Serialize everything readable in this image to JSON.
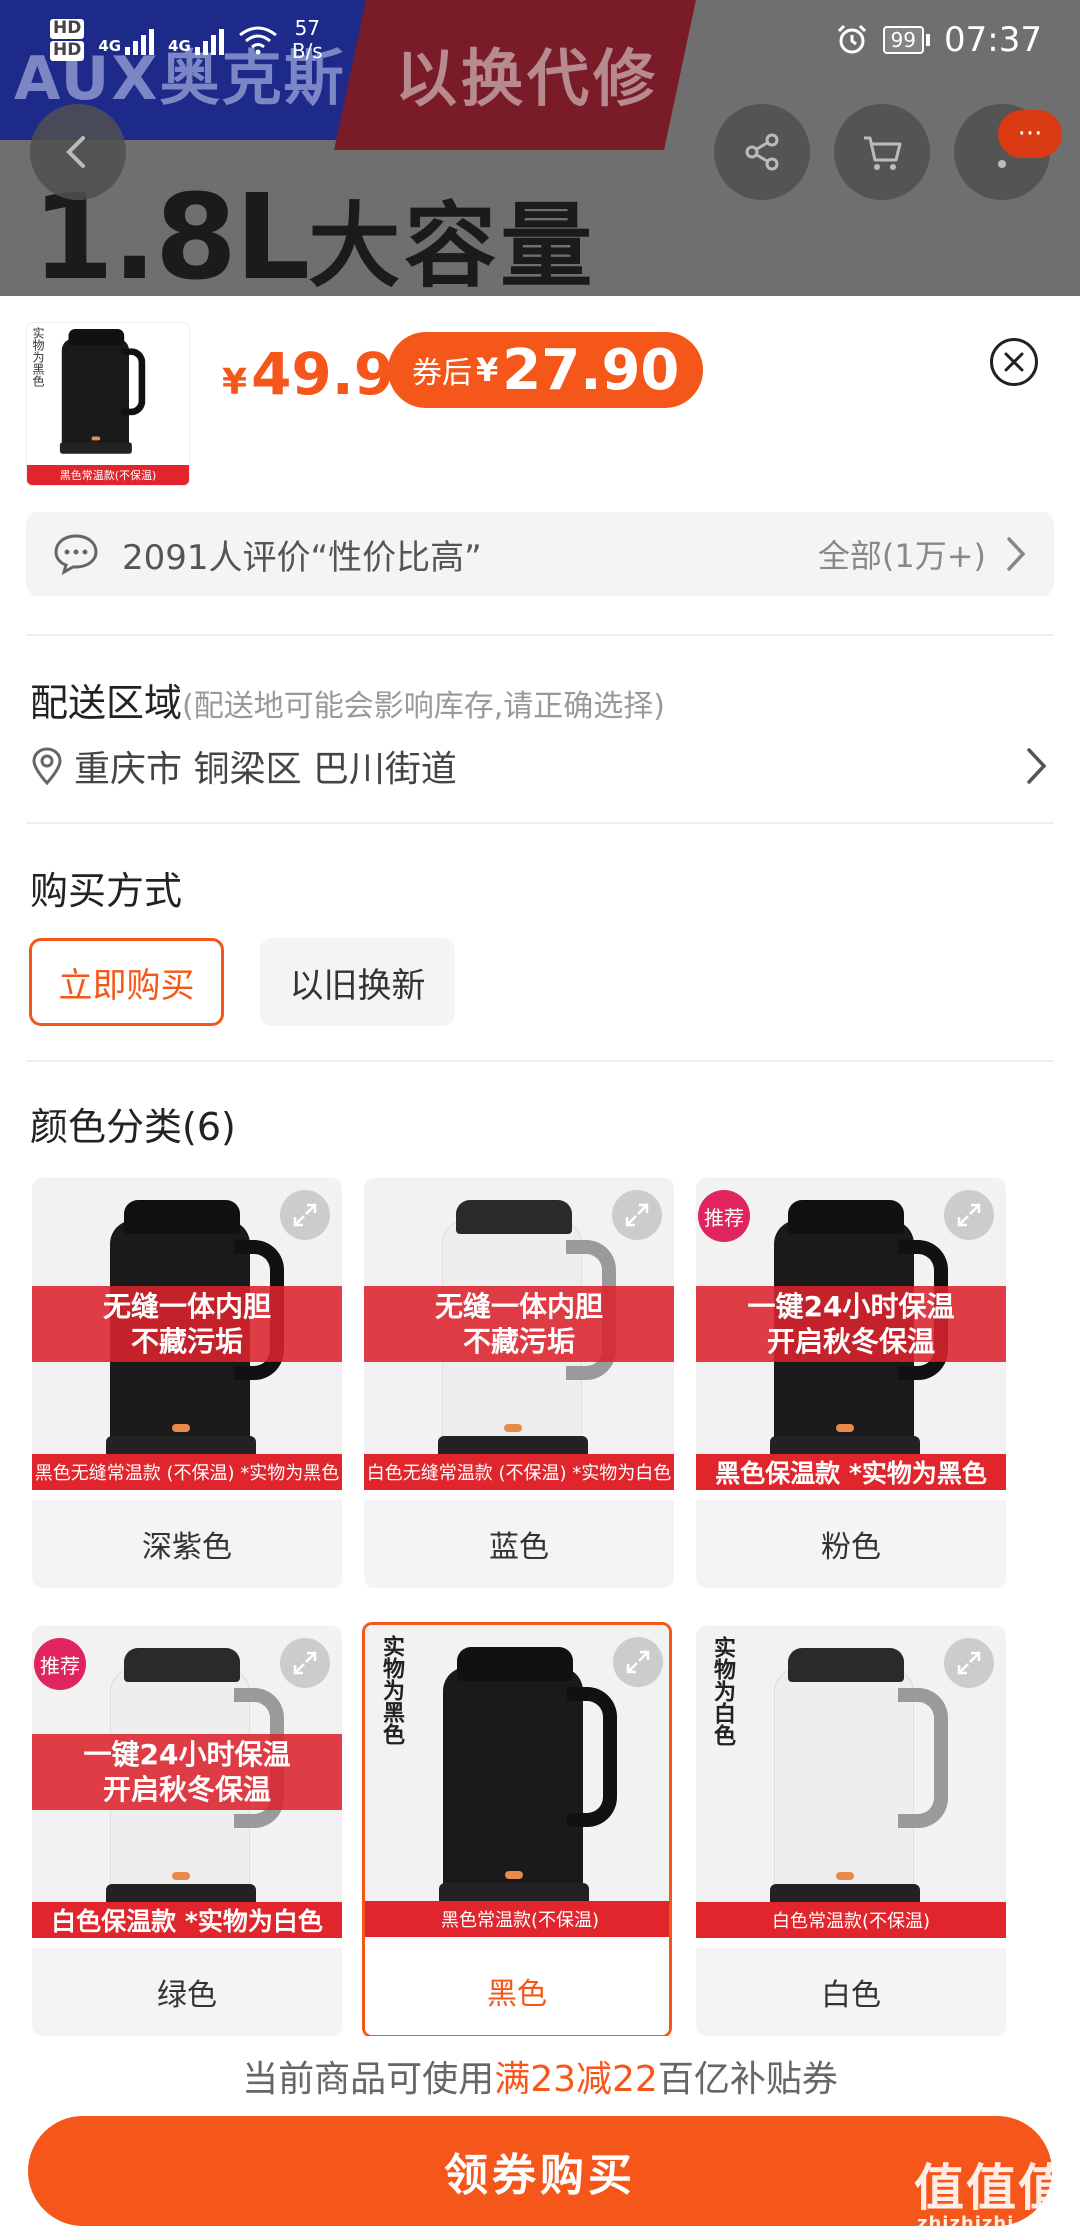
{
  "statusbar": {
    "hd1": "HD",
    "hd2": "HD",
    "net1": "4G",
    "net2": "4G",
    "speed_value": "57",
    "speed_unit": "B/s",
    "battery": "99",
    "time": "07:37"
  },
  "backdrop": {
    "brand": "AUX奥克斯",
    "slogan": "以换代修",
    "headline": "1.8L",
    "headline_sub": "大容量",
    "more_label": "···"
  },
  "product": {
    "thumb_vertical_label": "实物为黑色",
    "thumb_strip": "黑色常温款(不保温)",
    "price_currency": "¥",
    "price": "49.9",
    "coupon_label": "券后",
    "coupon_currency": "¥",
    "coupon_price": "27.90"
  },
  "review": {
    "text": "2091人评价“性价比高”",
    "all": "全部(1万+)"
  },
  "delivery": {
    "title": "配送区域",
    "hint": "(配送地可能会影响库存,请正确选择)",
    "address": "重庆市 铜梁区 巴川街道"
  },
  "purchase": {
    "title": "购买方式",
    "options": [
      "立即购买",
      "以旧换新"
    ]
  },
  "colors": {
    "title": "颜色分类(6)",
    "items": [
      {
        "name": "深紫色",
        "banner1": "无缝一体内胆",
        "banner2": "不藏污垢",
        "strip": "黑色无缝常温款 (不保温) *实物为黑色"
      },
      {
        "name": "蓝色",
        "banner1": "无缝一体内胆",
        "banner2": "不藏污垢",
        "strip": "白色无缝常温款 (不保温) *实物为白色"
      },
      {
        "name": "粉色",
        "tag": "推荐",
        "banner1": "一键24小时保温",
        "banner2": "开启秋冬保温",
        "strip": "黑色保温款 *实物为黑色"
      },
      {
        "name": "绿色",
        "tag": "推荐",
        "banner1": "一键24小时保温",
        "banner2": "开启秋冬保温",
        "strip": "白色保温款 *实物为白色"
      },
      {
        "name": "黑色",
        "vtag": "实物为黑色",
        "strip": "黑色常温款(不保温)"
      },
      {
        "name": "白色",
        "vtag": "实物为白色",
        "strip": "白色常温款(不保温)"
      }
    ]
  },
  "coupon_note": {
    "prefix": "当前商品可使用 ",
    "highlight": "满23减22",
    "suffix": " 百亿补贴券"
  },
  "buy_button": "领券购买",
  "watermark": {
    "logo": "值值值",
    "url": "zhizhizhi.com"
  },
  "colors_theme": {
    "accent": "#f5571a",
    "strip_red": "#e0252c"
  }
}
